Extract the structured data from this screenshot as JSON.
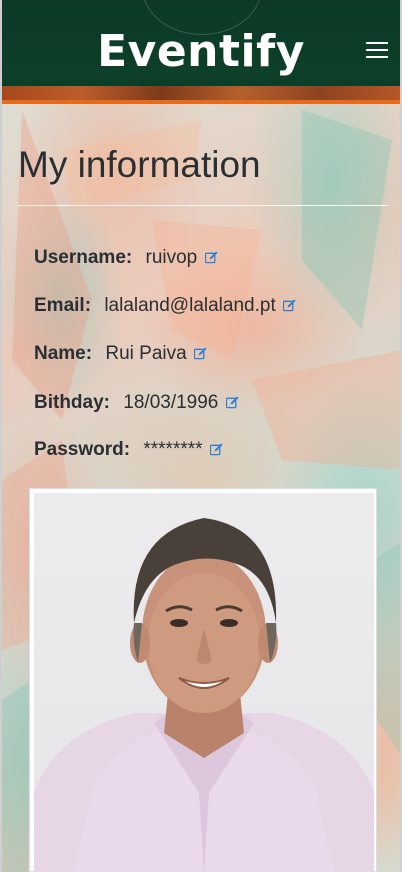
{
  "app": {
    "brand": "Eventify",
    "menu_icon": "hamburger-menu-icon"
  },
  "page": {
    "title": "My information"
  },
  "profile": {
    "fields": [
      {
        "label": "Username:",
        "value": "ruivop"
      },
      {
        "label": "Email:",
        "value": "lalaland@lalaland.pt"
      },
      {
        "label": "Name:",
        "value": "Rui Paiva"
      },
      {
        "label": "Bithday:",
        "value": "18/03/1996"
      },
      {
        "label": "Password:",
        "value": "********"
      }
    ],
    "edit_icon": "edit-icon",
    "photo": "profile-photo"
  },
  "colors": {
    "navbar": "#0d3f29",
    "accent_stripe": "#e56b1e",
    "edit_icon": "#2a7fd4",
    "text": "#2a2f33"
  }
}
